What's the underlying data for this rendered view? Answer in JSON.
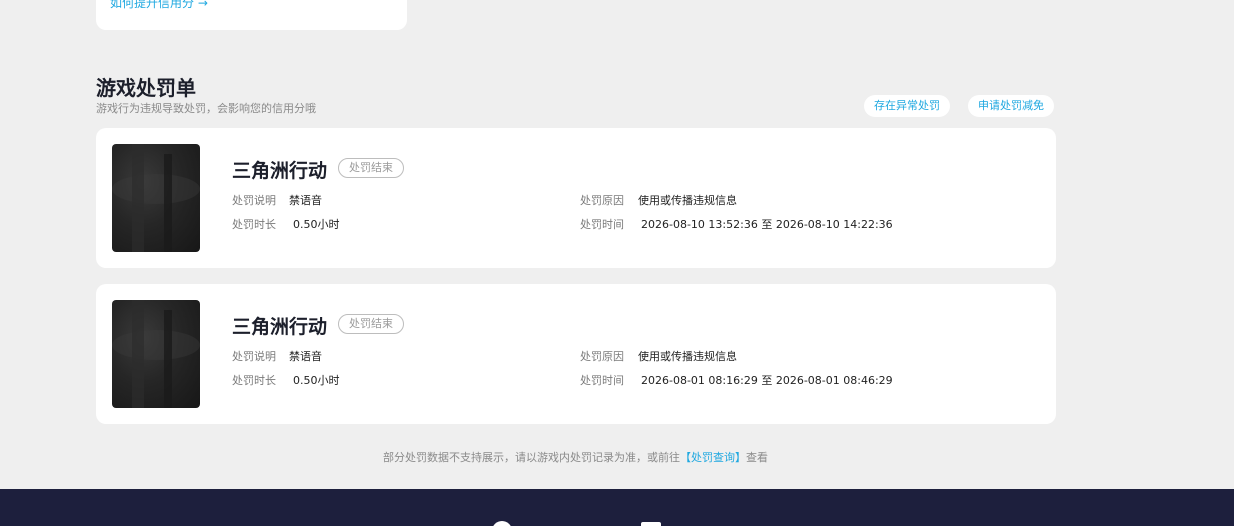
{
  "prev_section": {
    "link": "如何提升信用分 →"
  },
  "section": {
    "title": "游戏处罚单",
    "subtitle": "游戏行为违规导致处罚，会影响您的信用分哦",
    "actions": [
      "存在异常处罚",
      "申请处罚减免"
    ]
  },
  "labels": {
    "desc": "处罚说明",
    "reason": "处罚原因",
    "duration": "处罚时长",
    "time": "处罚时间"
  },
  "penalties": [
    {
      "game": "三角洲行动",
      "status": "处罚结束",
      "desc": "禁语音",
      "reason": "使用或传播违规信息",
      "duration": "0.50小时",
      "time": "2026-08-10 13:52:36 至 2026-08-10 14:22:36"
    },
    {
      "game": "三角洲行动",
      "status": "处罚结束",
      "desc": "禁语音",
      "reason": "使用或传播违规信息",
      "duration": "0.50小时",
      "time": "2026-08-01 08:16:29 至 2026-08-01 08:46:29"
    }
  ],
  "footer": {
    "note_prefix": "部分处罚数据不支持展示，请以游戏内处罚记录为准，或前往",
    "link": "【处罚查询】",
    "note_suffix": "查看"
  },
  "colors": {
    "accent": "#1fa8e0",
    "background": "#efefef",
    "bottom_bar": "#1d1f3d"
  }
}
